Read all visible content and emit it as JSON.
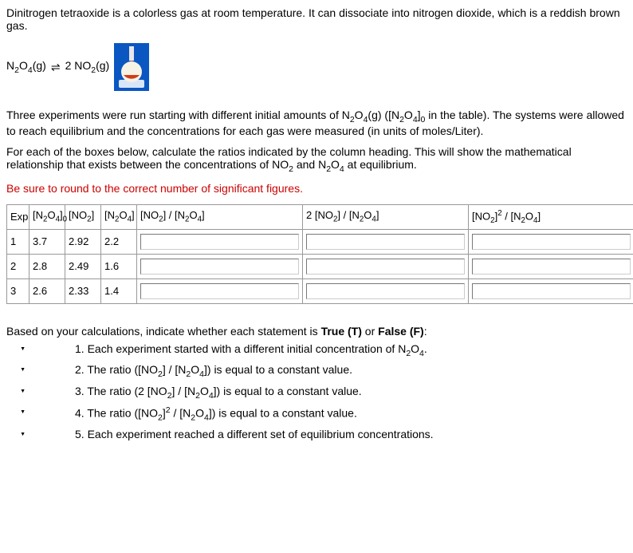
{
  "intro": "Dinitrogen tetraoxide is a colorless gas at room temperature. It can dissociate into nitrogen dioxide, which is a reddish brown gas.",
  "equation": {
    "left": "N₂O₄(g)",
    "arrow": "⇌",
    "right": "2 NO₂(g)"
  },
  "para1_a": "Three experiments were run starting with different initial amounts of N",
  "para1_b": "(g) ([N",
  "para1_c": " in the table). The systems were allowed to reach equilibrium and the concentrations for each gas were measured (in units of moles/Liter).",
  "para2_a": "For each of the boxes below, calculate the ratios indicated by the column heading. This will show the mathematical relationship that exists between the concentrations of NO",
  "para2_b": " and N",
  "para2_c": " at equilibrium.",
  "warn": "Be sure to round to the correct number of significant figures.",
  "headers": {
    "exp": "Exp",
    "n2o4_0_a": "[N",
    "n2o4_0_b": "]",
    "no2_a": "[NO",
    "no2_b": "]",
    "n2o4_a": "[N",
    "n2o4_b": "]",
    "r1_a": "[NO",
    "r1_b": "] / [N",
    "r1_c": "]",
    "r2_a": "2 [NO",
    "r2_b": "] / [N",
    "r2_c": "]",
    "r3_a": "[NO",
    "r3_b": "]",
    "r3_c": " / [N",
    "r3_d": "]"
  },
  "rows": [
    {
      "exp": "1",
      "n2o4_0": "3.7",
      "no2": "2.92",
      "n2o4": "2.2"
    },
    {
      "exp": "2",
      "n2o4_0": "2.8",
      "no2": "2.49",
      "n2o4": "1.6"
    },
    {
      "exp": "3",
      "n2o4_0": "2.6",
      "no2": "2.33",
      "n2o4": "1.4"
    }
  ],
  "statements_intro": "Based on your calculations, indicate whether each statement is ",
  "statements_intro_t": "True (T)",
  "statements_intro_or": " or ",
  "statements_intro_f": "False (F)",
  "statements_colon": ":",
  "stmt1_num": "1. ",
  "stmt1_a": "Each experiment started with a different initial concentration of N",
  "stmt1_b": ".",
  "stmt2_num": "2. ",
  "stmt2_a": "The ratio ([NO",
  "stmt2_b": "] / [N",
  "stmt2_c": "]) is equal to a constant value.",
  "stmt3_num": "3. ",
  "stmt3_a": "The ratio (2 [NO",
  "stmt3_b": "] / [N",
  "stmt3_c": "]) is equal to a constant value.",
  "stmt4_num": "4. ",
  "stmt4_a": "The ratio ([NO",
  "stmt4_b": "]",
  "stmt4_c": " / [N",
  "stmt4_d": "]) is equal to a constant value.",
  "stmt5_num": "5. ",
  "stmt5_a": "Each experiment reached a different set of equilibrium concentrations.",
  "sub_2": "2",
  "sub_4": "4",
  "sub_0": "0",
  "sup_2": "2"
}
